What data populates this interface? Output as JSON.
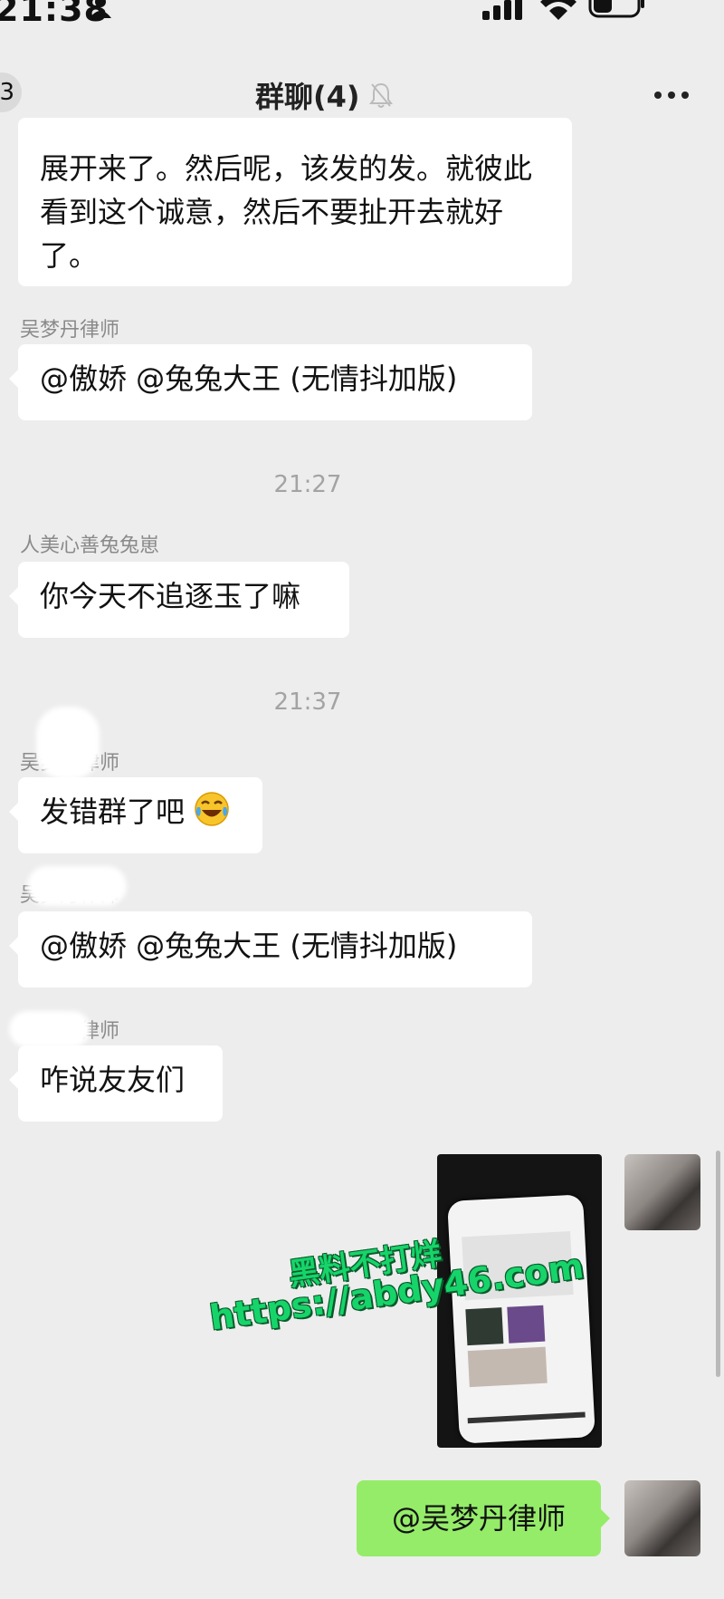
{
  "status_bar": {
    "time": "21:38"
  },
  "header": {
    "badge": "3",
    "title": "群聊(4)"
  },
  "messages": {
    "m1": {
      "text": "展开来了。然后呢，该发的发。就彼此看到这个诚意，然后不要扯开去就好了。"
    },
    "m2": {
      "sender": "吴梦丹律师",
      "text": "@傲娇 @兔兔大王 (无情抖加版)"
    },
    "ts1": "21:27",
    "m3": {
      "sender": "人美心善兔兔崽",
      "text": "你今天不追逐玉了嘛"
    },
    "ts2": "21:37",
    "m4": {
      "sender": "吴梦丹律师",
      "text": "发错群了吧"
    },
    "m5": {
      "sender": "吴梦丹律师",
      "text": "@傲娇 @兔兔大王 (无情抖加版)"
    },
    "m6": {
      "sender": "吴梦丹律师",
      "text": "咋说友友们"
    },
    "self_text": "@吴梦丹律师"
  },
  "watermark": {
    "line1": "黑料不打烊",
    "line2": "https://abdy46.com"
  },
  "colors": {
    "bg": "#ededed",
    "bubble_left": "#ffffff",
    "bubble_right": "#95ec69"
  }
}
